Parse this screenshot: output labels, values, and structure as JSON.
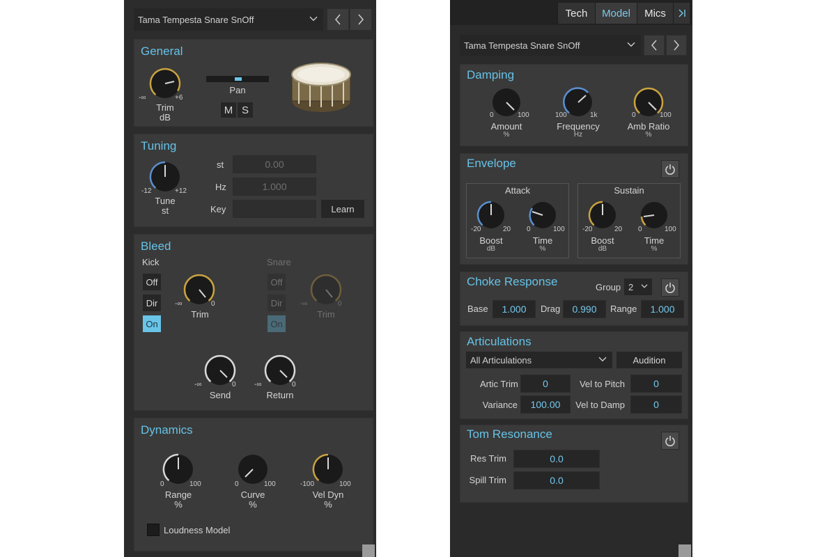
{
  "left": {
    "preset": "Tama Tempesta Snare SnOff",
    "general": {
      "title": "General",
      "trim": {
        "min": "-∞",
        "max": "+6",
        "label": "Trim",
        "unit": "dB"
      },
      "pan": {
        "label": "Pan"
      },
      "mute": "M",
      "solo": "S"
    },
    "tuning": {
      "title": "Tuning",
      "tune": {
        "min": "-12",
        "max": "+12",
        "label": "Tune",
        "unit": "st"
      },
      "st_label": "st",
      "st_value": "0.00",
      "hz_label": "Hz",
      "hz_value": "1.000",
      "key_label": "Key",
      "key_value": "",
      "learn": "Learn"
    },
    "bleed": {
      "title": "Bleed",
      "kick": {
        "label": "Kick",
        "off": "Off",
        "dir": "Dir",
        "on": "On",
        "trim": {
          "min": "-∞",
          "max": "0",
          "label": "Trim"
        }
      },
      "snare": {
        "label": "Snare",
        "off": "Off",
        "dir": "Dir",
        "on": "On",
        "trim": {
          "min": "-∞",
          "max": "0",
          "label": "Trim"
        }
      },
      "send": {
        "min": "-∞",
        "max": "0",
        "label": "Send"
      },
      "return": {
        "min": "-∞",
        "max": "0",
        "label": "Return"
      }
    },
    "dynamics": {
      "title": "Dynamics",
      "range": {
        "min": "0",
        "max": "100",
        "label": "Range",
        "unit": "%"
      },
      "curve": {
        "min": "0",
        "max": "100",
        "label": "Curve",
        "unit": "%"
      },
      "veldyn": {
        "min": "-100",
        "max": "100",
        "label": "Vel Dyn",
        "unit": "%"
      },
      "loudness": "Loudness Model"
    }
  },
  "right": {
    "tabs": [
      "Tech",
      "Model",
      "Mics"
    ],
    "active_tab": "Model",
    "preset": "Tama Tempesta Snare SnOff",
    "damping": {
      "title": "Damping",
      "amount": {
        "min": "0",
        "max": "100",
        "label": "Amount",
        "unit": "%"
      },
      "frequency": {
        "min": "100",
        "max": "1k",
        "label": "Frequency",
        "unit": "Hz"
      },
      "amb": {
        "min": "0",
        "max": "100",
        "label": "Amb Ratio",
        "unit": "%"
      }
    },
    "envelope": {
      "title": "Envelope",
      "attack": {
        "title": "Attack",
        "boost": {
          "min": "-20",
          "max": "20",
          "label": "Boost",
          "unit": "dB"
        },
        "time": {
          "min": "0",
          "max": "100",
          "label": "Time",
          "unit": "%"
        }
      },
      "sustain": {
        "title": "Sustain",
        "boost": {
          "min": "-20",
          "max": "20",
          "label": "Boost",
          "unit": "dB"
        },
        "time": {
          "min": "0",
          "max": "100",
          "label": "Time",
          "unit": "%"
        }
      }
    },
    "choke": {
      "title": "Choke Response",
      "group_label": "Group",
      "group_value": "2",
      "base_label": "Base",
      "base_value": "1.000",
      "drag_label": "Drag",
      "drag_value": "0.990",
      "range_label": "Range",
      "range_value": "1.000"
    },
    "artic": {
      "title": "Articulations",
      "select": "All Articulations",
      "audition": "Audition",
      "artic_trim_label": "Artic Trim",
      "artic_trim": "0",
      "vel_pitch_label": "Vel to Pitch",
      "vel_pitch": "0",
      "variance_label": "Variance",
      "variance": "100.00",
      "vel_damp_label": "Vel to Damp",
      "vel_damp": "0"
    },
    "tom": {
      "title": "Tom Resonance",
      "res_label": "Res Trim",
      "res_value": "0.0",
      "spill_label": "Spill Trim",
      "spill_value": "0.0"
    }
  },
  "colors": {
    "accent": "#66c2e6",
    "knob_gold": "#c9a340",
    "knob_blue": "#5b8fd0",
    "knob_white": "#d8d8d8"
  }
}
